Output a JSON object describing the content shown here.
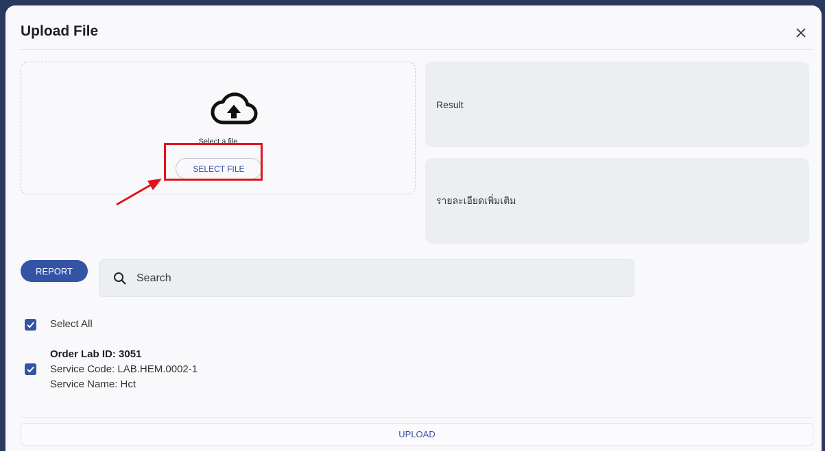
{
  "dialog": {
    "title": "Upload File",
    "close_icon": "close-icon"
  },
  "dropzone": {
    "icon": "cloud-upload-icon",
    "prompt": "Select a file",
    "button_label": "SELECT FILE"
  },
  "panels": {
    "result_label": "Result",
    "details_label": "รายละเอียดเพิ่มเติม"
  },
  "toolbar": {
    "report_label": "REPORT",
    "search_placeholder": "Search",
    "search_value": ""
  },
  "selection": {
    "select_all_label": "Select All",
    "select_all_checked": true
  },
  "items": [
    {
      "order_id": "Order Lab ID: 3051",
      "service_code": "Service Code: LAB.HEM.0002-1",
      "service_name": "Service Name: Hct",
      "checked": true
    }
  ],
  "footer": {
    "upload_label": "UPLOAD"
  },
  "colors": {
    "primary": "#3354a4",
    "highlight": "#e0131b",
    "panel": "#eceff2"
  }
}
